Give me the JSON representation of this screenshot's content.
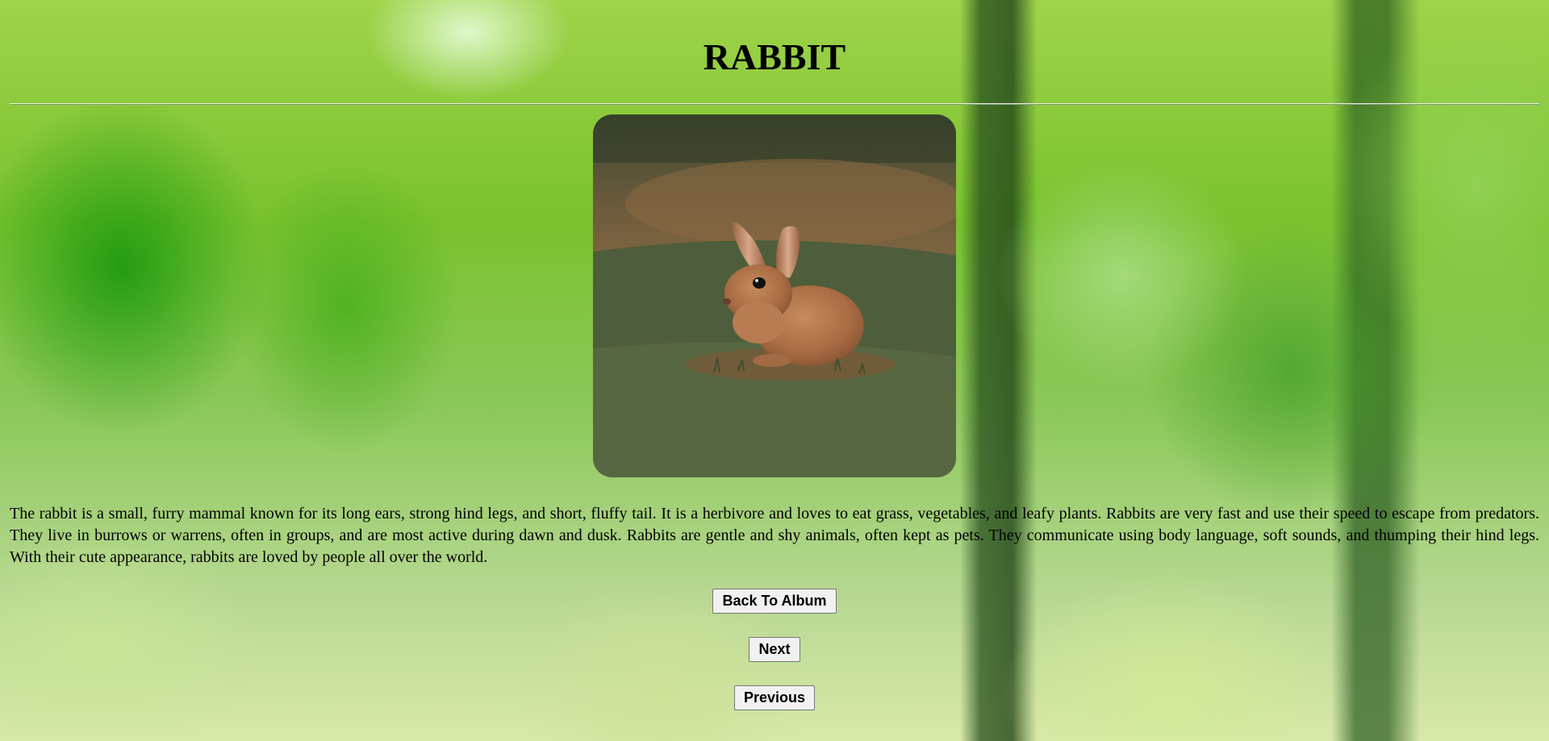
{
  "page": {
    "title": "RABBIT",
    "background_icon": "blurred-forest-background",
    "image_icon": "rabbit-photo"
  },
  "description": "The rabbit is a small, furry mammal known for its long ears, strong hind legs, and short, fluffy tail. It is a herbivore and loves to eat grass, vegetables, and leafy plants. Rabbits are very fast and use their speed to escape from predators. They live in burrows or warrens, often in groups, and are most active during dawn and dusk. Rabbits are gentle and shy animals, often kept as pets. They communicate using body language, soft sounds, and thumping their hind legs. With their cute appearance, rabbits are loved by people all over the world.",
  "buttons": {
    "back_label": "Back To Album",
    "next_label": "Next",
    "previous_label": "Previous"
  },
  "colors": {
    "background_green": "#79c22e",
    "rabbit_fur": "#b07449",
    "grass": "#4f5f3a"
  }
}
